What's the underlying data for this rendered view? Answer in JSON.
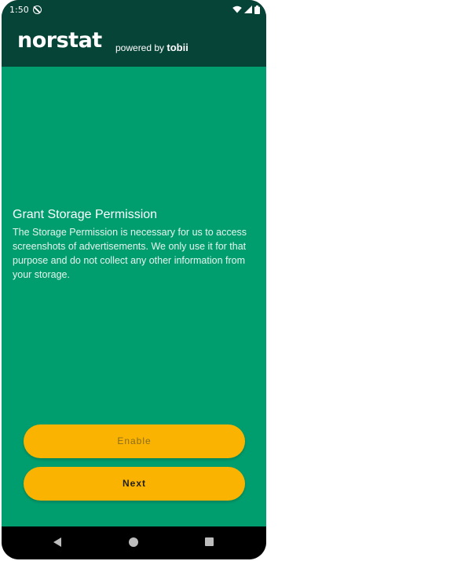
{
  "status_bar": {
    "time": "1:50",
    "icons": [
      "app-notification-icon",
      "wifi-icon",
      "cellular-signal-icon",
      "battery-icon"
    ]
  },
  "header": {
    "logo": "norstat",
    "powered_by_prefix": "powered by",
    "powered_by_brand": "tobii"
  },
  "permission": {
    "title": "Grant Storage Permission",
    "body": "The Storage Permission is necessary for us to access screenshots of advertisements. We only use it for that purpose and do not collect any other information from your storage."
  },
  "buttons": {
    "enable_label": "Enable",
    "next_label": "Next"
  },
  "nav": {
    "icons": [
      "back-icon",
      "home-icon",
      "recents-icon"
    ]
  },
  "colors": {
    "header_bg": "#074438",
    "content_bg": "#009e6e",
    "button_bg": "#fbb301",
    "nav_bg": "#000000"
  }
}
